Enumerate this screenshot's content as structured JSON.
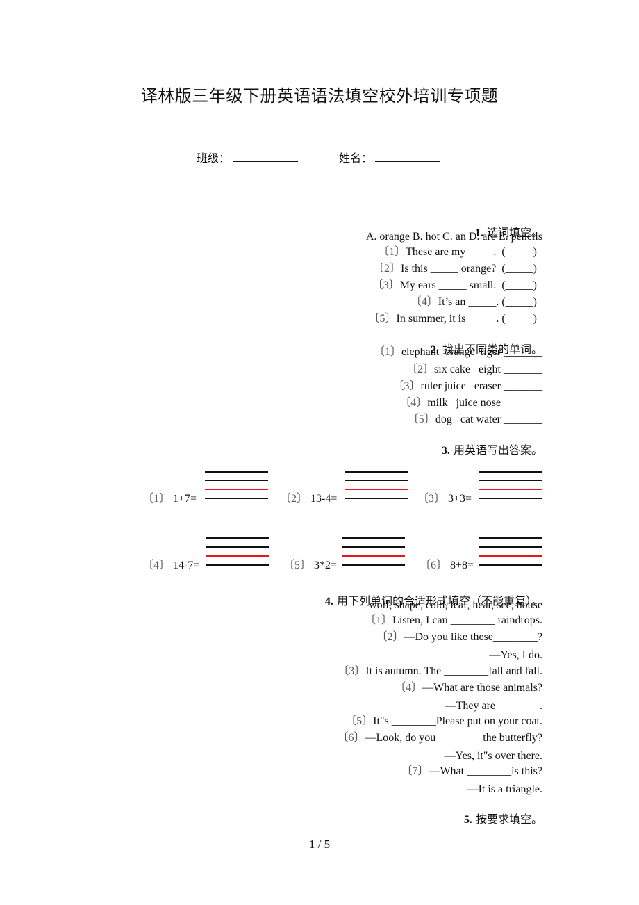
{
  "title": "译林版三年级下册英语语法填空校外培训专项题",
  "info": {
    "class_label": "班级：",
    "name_label": "姓名："
  },
  "section1": {
    "number": "1.",
    "heading": "选词填空。",
    "options": "A. orange B. hot C. an D. are E. pencils",
    "items": [
      {
        "num": "〔1〕",
        "text": "These are my_____.  (_____)"
      },
      {
        "num": "〔2〕",
        "text": "Is this _____ orange?  (_____)"
      },
      {
        "num": "〔3〕",
        "text": "My ears _____ small.  (_____)"
      },
      {
        "num": "〔4〕",
        "text": "It’s an _____. (_____)"
      },
      {
        "num": "〔5〕",
        "text": "In summer, it is _____. (_____)"
      }
    ]
  },
  "section2": {
    "number": "2.",
    "heading": "找出不同类的单词。",
    "items": [
      {
        "num": "〔1〕",
        "text": "elephant  orange  tiger _______"
      },
      {
        "num": "〔2〕",
        "text": "six cake   eight _______"
      },
      {
        "num": "〔3〕",
        "text": "ruler juice   eraser _______"
      },
      {
        "num": "〔4〕",
        "text": "milk   juice nose _______"
      },
      {
        "num": "〔5〕",
        "text": "dog   cat water _______"
      }
    ]
  },
  "section3": {
    "number": "3.",
    "heading": "用英语写出答案。",
    "items": [
      {
        "num": "〔1〕",
        "expr": "1+7="
      },
      {
        "num": "〔2〕",
        "expr": "13-4="
      },
      {
        "num": "〔3〕",
        "expr": "3+3="
      },
      {
        "num": "〔4〕",
        "expr": "14-7="
      },
      {
        "num": "〔5〕",
        "expr": "3*2="
      },
      {
        "num": "〔6〕",
        "expr": "8+8="
      }
    ],
    "grid_colors": {
      "normal": "#111111",
      "red": "#e8141b"
    }
  },
  "section4": {
    "number": "4.",
    "heading": "用下列单词的合适形式填空（不能重复）。",
    "words": "wolf, shape, cold, leaf, hear, see, house",
    "lines": [
      {
        "num": "〔1〕",
        "text": "Listen, I can ________ raindrops."
      },
      {
        "num": "〔2〕",
        "text": "—Do you like these________?"
      },
      {
        "num": "",
        "text": "—Yes, I do."
      },
      {
        "num": "〔3〕",
        "text": "It is autumn. The ________fall and fall."
      },
      {
        "num": "〔4〕",
        "text": "—What are those animals?"
      },
      {
        "num": "",
        "text": "—They are________."
      },
      {
        "num": "〔5〕",
        "text": "It\"s ________Please put on your coat."
      },
      {
        "num": "〔6〕",
        "text": "—Look, do you ________the butterfly?"
      },
      {
        "num": "",
        "text": "—Yes, it\"s over there."
      },
      {
        "num": "〔7〕",
        "text": "—What ________is this?"
      },
      {
        "num": "",
        "text": "—It is a triangle."
      }
    ]
  },
  "section5": {
    "number": "5.",
    "heading": "按要求填空。"
  },
  "page": "1 / 5"
}
